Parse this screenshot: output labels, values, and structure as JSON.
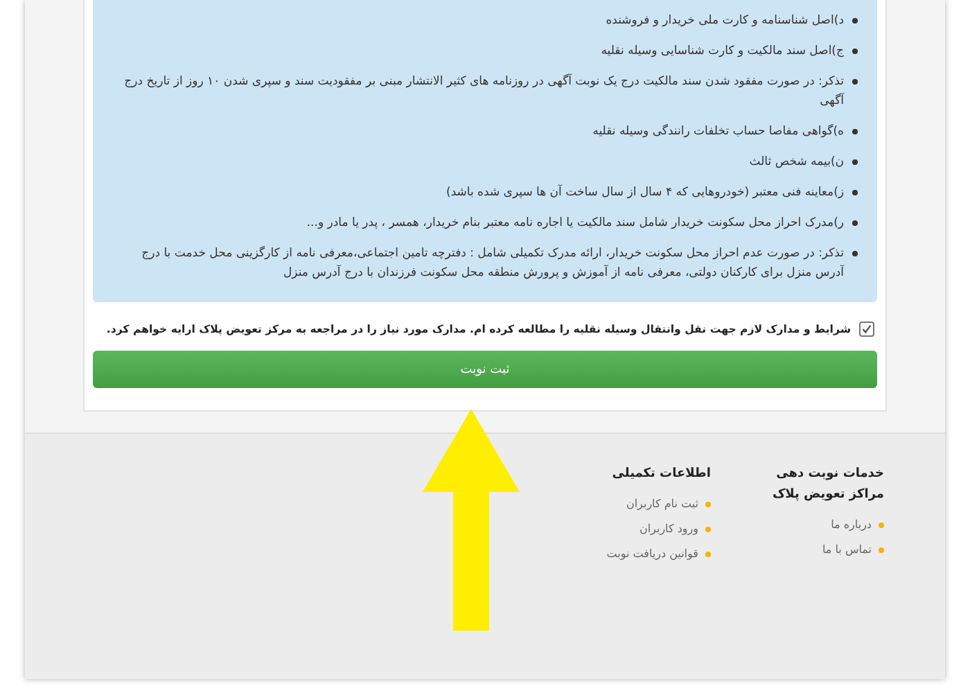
{
  "requirements": [
    {
      "text": "د)اصل شناسنامه و کارت ملی خریدار و فروشنده"
    },
    {
      "text": "ج)اصل سند مالکیت و کارت شناسایی وسیله نقلیه"
    },
    {
      "text": "تذکر: در صورت مفقود شدن سند مالکیت درج یک نوبت آگهی در روزنامه های کثیر الانتشار مبنی بر مفقودیت سند و سپری شدن ۱۰ روز از تاریخ درج آگهی"
    },
    {
      "text": "ه)گواهی مفاصا حساب تخلفات رانندگی وسیله نقلیه"
    },
    {
      "text": "ن)بیمه شخص ثالث"
    },
    {
      "text": "ز)معاینه فنی معتبر (خودروهایی که ۴ سال از سال ساخت آن ها سپری شده باشد)"
    },
    {
      "text": "ر)مدرک احراز محل سکونت خریدار شامل سند مالکیت یا اجاره نامه معتبر بنام خریدار، همسر ، پدر یا مادر و..."
    },
    {
      "text": "تذکر: در صورت عدم احراز محل سکونت خریدار، ارائه مدرک تکمیلی شامل : دفترچه تامین اجتماعی،معرفی نامه از کارگزینی محل خدمت با درج آدرس منزل برای کارکنان دولتی، معرفی نامه از آموزش و پرورش منطقه محل سکونت فرزندان با درج آدرس منزل"
    }
  ],
  "agreement": {
    "label": "شرایط و مدارک لازم جهت نقل وانتقال وسیله نقلیه را مطالعه کرده ام. مدارک مورد نیاز را در مراجعه به مرکز تعویض پلاک ارایه خواهم کرد.",
    "checked": true
  },
  "submit_button": "ثبت نوبت",
  "footer": [
    {
      "title": "خدمات نوبت دهی مراکز تعویض پلاک",
      "links": [
        "درباره ما",
        "تماس با ما"
      ]
    },
    {
      "title": "اطلاعات تکمیلی",
      "links": [
        "ثبت نام کاربران",
        "ورود کاربران",
        "قوانین دریافت نوبت"
      ]
    }
  ]
}
